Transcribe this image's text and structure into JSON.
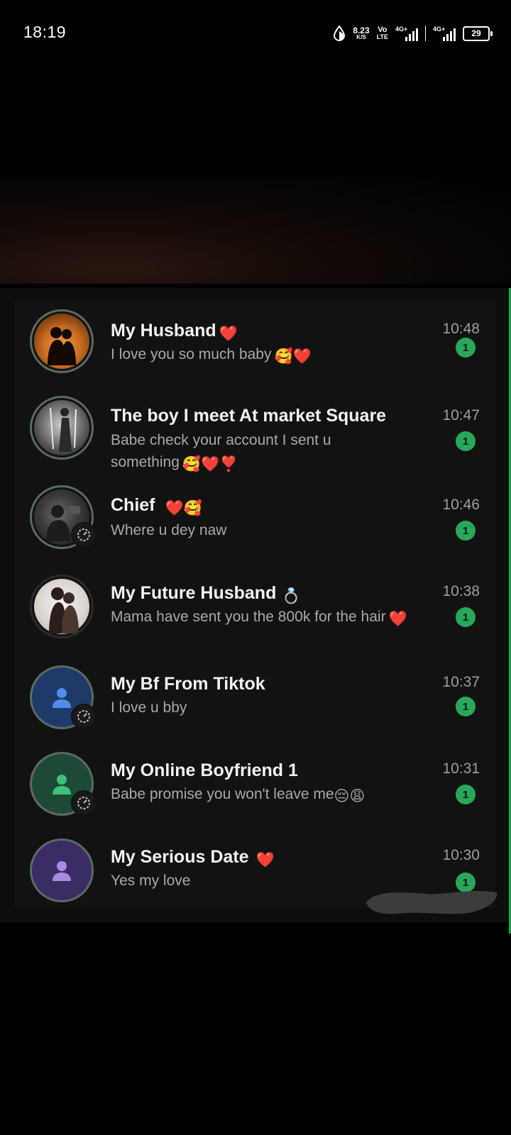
{
  "status_bar": {
    "time": "18:19",
    "net_speed_value": "8.23",
    "net_speed_unit": "K/S",
    "volte_top": "Vo",
    "volte_bottom": "LTE",
    "sim1_label": "4G+",
    "sim2_label": "4G+",
    "battery": "29"
  },
  "chats": [
    {
      "name": "My Husband",
      "name_emoji": "❤️",
      "preview": "I love you so much baby",
      "preview_emoji": "🥰❤️",
      "time": "10:48",
      "unread": "1"
    },
    {
      "name": "The boy I meet At  market Square",
      "name_emoji": "",
      "preview": "Babe check your account I sent u something",
      "preview_emoji": "🥰❤️❣️",
      "time": "10:47",
      "unread": "1"
    },
    {
      "name": "Chief",
      "name_emoji": "❤️🥰",
      "preview": "Where u dey naw",
      "preview_emoji": "",
      "time": "10:46",
      "unread": "1"
    },
    {
      "name": "My Future Husband",
      "name_emoji": "💍",
      "preview": "Mama have sent you the 800k for the hair",
      "preview_emoji": "❤️",
      "time": "10:38",
      "unread": "1"
    },
    {
      "name": "My Bf From Tiktok",
      "name_emoji": "",
      "preview": "I love u bby",
      "preview_emoji": "",
      "time": "10:37",
      "unread": "1"
    },
    {
      "name": "My Online Boyfriend 1",
      "name_emoji": "",
      "preview": "Babe promise you won't leave me",
      "preview_emoji": "😔😩",
      "time": "10:31",
      "unread": "1"
    },
    {
      "name": "My Serious Date",
      "name_emoji": "❤️",
      "preview": "Yes my love",
      "preview_emoji": "",
      "time": "10:30",
      "unread": "1"
    }
  ],
  "colors": {
    "unread_badge": "#27a85a",
    "heart": "#e8373d",
    "avatar_blue": "#1f3a68",
    "avatar_green": "#1d4a36",
    "avatar_purple": "#3b2c63"
  }
}
